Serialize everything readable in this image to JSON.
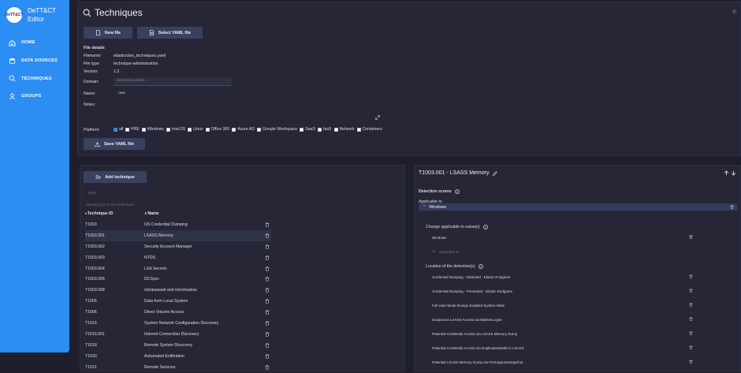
{
  "sidebar": {
    "logo_text": "DeTT&CT",
    "app_title": "DeTT&CT Editor",
    "items": [
      {
        "label": "HOME",
        "icon": "home-icon"
      },
      {
        "label": "DATA SOURCES",
        "icon": "database-icon"
      },
      {
        "label": "TECHNIQUES",
        "icon": "search-icon"
      },
      {
        "label": "GROUPS",
        "icon": "user-icon"
      }
    ]
  },
  "header": {
    "title": "Techniques"
  },
  "toolbar": {
    "new_file": "New file",
    "select_yaml": "Select YAML file",
    "save_yaml": "Save YAML file"
  },
  "file_details": {
    "heading": "File details",
    "filename_label": "Filename:",
    "filename": "elasticrules_techniques.yaml",
    "filetype_label": "File type:",
    "filetype": "technique-administration",
    "version_label": "Version:",
    "version": "1.2",
    "domain_label": "Domain:",
    "domain": "enterprise-attack",
    "name_label": "Name:",
    "name": "new",
    "notes_label": "Notes:",
    "platform_label": "Platform:"
  },
  "platforms": [
    {
      "label": "all",
      "checked": true
    },
    {
      "label": "PRE",
      "checked": false
    },
    {
      "label": "Windows",
      "checked": false
    },
    {
      "label": "macOS",
      "checked": false
    },
    {
      "label": "Linux",
      "checked": false
    },
    {
      "label": "Office 365",
      "checked": false
    },
    {
      "label": "Azure AD",
      "checked": false
    },
    {
      "label": "Google Workspace",
      "checked": false
    },
    {
      "label": "SaaS",
      "checked": false
    },
    {
      "label": "IaaS",
      "checked": false
    },
    {
      "label": "Network",
      "checked": false
    },
    {
      "label": "Containers",
      "checked": false
    }
  ],
  "technique_list": {
    "add_button": "Add technique",
    "filter_placeholder": "Filter",
    "count_text": "Showing 222 of 222 techniques",
    "col_id": "Technique ID",
    "col_name": "Name",
    "rows": [
      {
        "id": "T1003",
        "name": "OS Credential Dumping"
      },
      {
        "id": "T1003.001",
        "name": "LSASS Memory"
      },
      {
        "id": "T1003.002",
        "name": "Security Account Manager"
      },
      {
        "id": "T1003.003",
        "name": "NTDS"
      },
      {
        "id": "T1003.004",
        "name": "LSA Secrets"
      },
      {
        "id": "T1003.006",
        "name": "DCSync"
      },
      {
        "id": "T1003.008",
        "name": "/etc/passwd and /etc/shadow"
      },
      {
        "id": "T1005",
        "name": "Data from Local System"
      },
      {
        "id": "T1006",
        "name": "Direct Volume Access"
      },
      {
        "id": "T1016",
        "name": "System Network Configuration Discovery"
      },
      {
        "id": "T1016.001",
        "name": "Internet Connection Discovery"
      },
      {
        "id": "T1018",
        "name": "Remote System Discovery"
      },
      {
        "id": "T1020",
        "name": "Automated Exfiltration"
      },
      {
        "id": "T1021",
        "name": "Remote Services"
      }
    ]
  },
  "detail": {
    "title": "T1003.001 - LSASS Memory",
    "scores_label": "Detection scores",
    "applicable_label": "Applicable to",
    "group_title": "Windows",
    "change_label": "Change applicable to value(s)",
    "applicable_value": "Windows",
    "applicable_placeholder": "applicable to",
    "location_label": "Location of the detection(s)",
    "locations": [
      "Credential Dumping - Detected - Elastic Endgame",
      "Credential Dumping - Prevented - Elastic Endgame",
      "Full User-Mode Dumps Enabled System-Wide",
      "Suspicious LSASS Access via MalSecLogon",
      "Potential Credential Access via LSASS Memory Dump",
      "Potential Credential Access via DuplicateHandle in LSASS",
      "Potential LSASS Memory Dump via PssCaptureSnapShot"
    ]
  }
}
